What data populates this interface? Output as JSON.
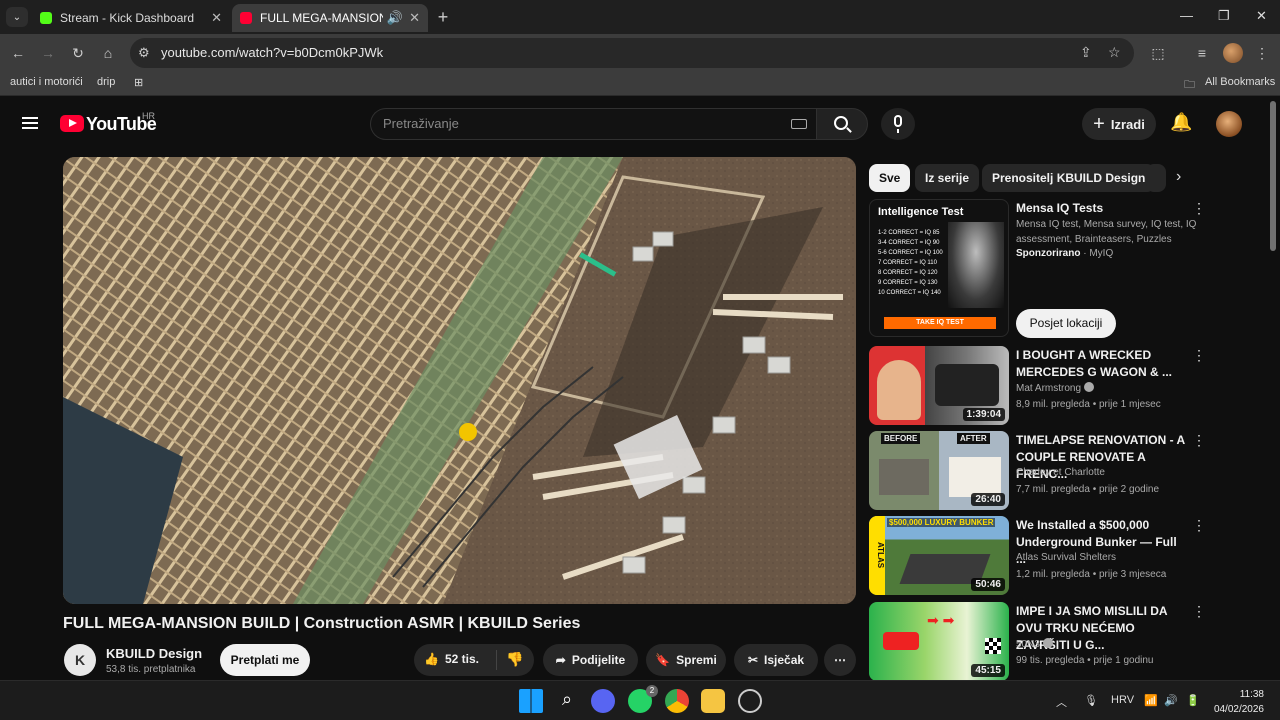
{
  "browser": {
    "tabs": [
      {
        "title": "Stream - Kick Dashboard",
        "favicon": "kick-icon"
      },
      {
        "title": "FULL MEGA-MANSION BUIL",
        "favicon": "youtube-icon",
        "active": true
      }
    ],
    "url": "youtube.com/watch?v=b0Dcm0kPJWk",
    "bookmarks": [
      "autici i motorići",
      "drip"
    ],
    "all_bookmarks": "All Bookmarks"
  },
  "youtube": {
    "logo": "YouTube",
    "region": "HR",
    "search_placeholder": "Pretraživanje",
    "create_label": "Izradi",
    "video": {
      "title": "FULL MEGA-MANSION BUILD | Construction ASMR | KBUILD Series",
      "channel": "KBUILD Design",
      "channel_initial": "K",
      "subscribers": "53,8 tis. pretplatnika",
      "subscribe_label": "Pretplati me",
      "likes": "52 tis.",
      "share_label": "Podijelite",
      "save_label": "Spremi",
      "clip_label": "Isječak"
    },
    "chips": [
      "Sve",
      "Iz serije",
      "Prenositelj KBUILD Design"
    ],
    "ad": {
      "title": "Mensa IQ Tests",
      "description": "Mensa IQ test, Mensa survey, IQ test, IQ assessment, Brainteasers, Puzzles",
      "sponsored": "Sponzorirano",
      "advertiser": "MyIQ",
      "visit_label": "Posjet lokaciji",
      "thumb_title": "Intelligence Test",
      "thumb_lines": [
        "1-2 CORRECT = IQ 85",
        "3-4 CORRECT = IQ 90",
        "5-6 CORRECT = IQ 100",
        "7 CORRECT = IQ 110",
        "8 CORRECT = IQ 120",
        "9 CORRECT = IQ 130",
        "10 CORRECT = IQ 140"
      ],
      "thumb_cta": "TAKE IQ TEST"
    },
    "recommendations": [
      {
        "title": "I BOUGHT A WRECKED MERCEDES G WAGON & ...",
        "channel": "Mat Armstrong",
        "verified": true,
        "views": "8,9 mil. pregleda",
        "age": "prije 1 mjesec",
        "duration": "1:39:04"
      },
      {
        "title": "TIMELAPSE RENOVATION - A COUPLE RENOVATE A FRENC...",
        "channel": "Charley et Charlotte",
        "verified": false,
        "views": "7,7 mil. pregleda",
        "age": "prije 2 godine",
        "duration": "26:40",
        "thumb_labels": [
          "BEFORE",
          "AFTER"
        ]
      },
      {
        "title": "We Installed a $500,000 Underground Bunker — Full ...",
        "channel": "Atlas Survival Shelters",
        "verified": false,
        "views": "1,2 mil. pregleda",
        "age": "prije 3 mjeseca",
        "duration": "50:46",
        "thumb_labels": [
          "$500,000 LUXURY BUNKER",
          "ATLAS"
        ]
      },
      {
        "title": "IMPE I JA SMO MISLILI DA OVU TRKU NEĆEMO ZAVRŠITI U G...",
        "channel": "50N3",
        "verified": true,
        "views": "99 tis. pregleda",
        "age": "prije 1 godinu",
        "duration": "45:15"
      }
    ]
  },
  "taskbar": {
    "language": "HRV",
    "time": "11:38",
    "date": "04/02/2026",
    "whatsapp_badge": "2"
  },
  "colors": {
    "yt_red": "#ff0033",
    "bg": "#0f0f0f",
    "chip": "#272727"
  }
}
